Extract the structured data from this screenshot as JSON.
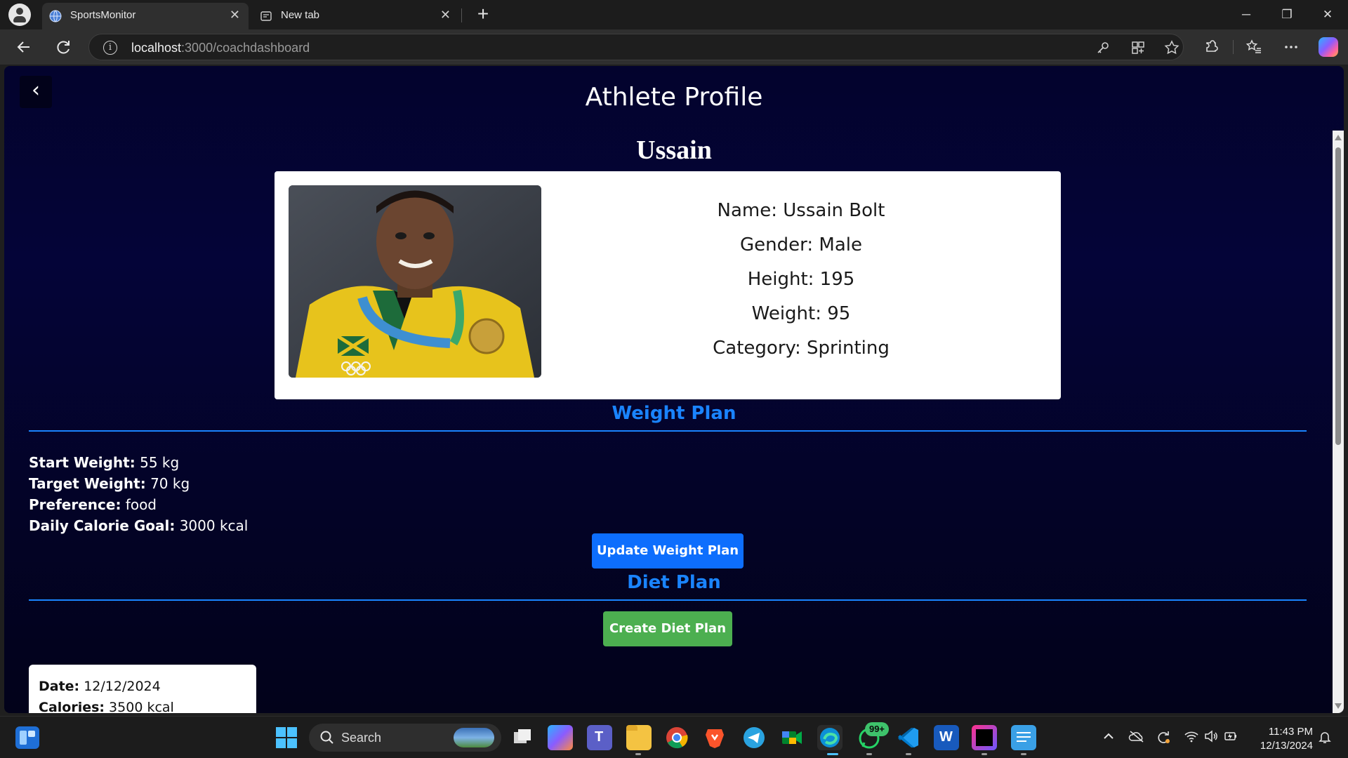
{
  "browser": {
    "tabs": [
      {
        "title": "SportsMonitor",
        "active": true
      },
      {
        "title": "New tab",
        "active": false
      }
    ],
    "tab_close_glyph": "✕",
    "new_tab_glyph": "+",
    "url_host": "localhost",
    "url_path": ":3000/coachdashboard",
    "window_controls": [
      "─",
      "❐",
      "✕"
    ],
    "icons": [
      "back-icon",
      "refresh-icon",
      "info-icon",
      "key-icon",
      "apps-icon",
      "star-icon",
      "extensions-icon",
      "favorites-icon",
      "more-icon",
      "copilot-icon"
    ]
  },
  "page": {
    "back_glyph": "‹",
    "title": "Athlete Profile",
    "athlete_first_name": "Ussain",
    "profile": {
      "name": "Name: Ussain Bolt",
      "gender": "Gender: Male",
      "height": "Height: 195",
      "weight": "Weight: 95",
      "category": "Category: Sprinting"
    },
    "weight_plan": {
      "heading": "Weight Plan",
      "start_label": "Start Weight:",
      "start_value": " 55 kg",
      "target_label": "Target Weight:",
      "target_value": " 70 kg",
      "preference_label": "Preference:",
      "preference_value": " food",
      "calorie_label": "Daily Calorie Goal:",
      "calorie_value": " 3000 kcal",
      "update_button": "Update Weight Plan"
    },
    "diet_plan": {
      "heading": "Diet Plan",
      "create_button": "Create Diet Plan",
      "entries": [
        {
          "date_label": "Date:",
          "date_value": " 12/12/2024",
          "calories_label": "Calories:",
          "calories_value": " 3500 kcal"
        }
      ]
    },
    "colors": {
      "background": "#03032d",
      "accent_blue": "#1a84ff",
      "button_blue": "#0d6efd",
      "button_green": "#4caf50"
    }
  },
  "taskbar": {
    "search_label": "Search",
    "whatsapp_badge": "99+",
    "time": "11:43 PM",
    "date": "12/13/2024",
    "apps": [
      "widgets-icon",
      "start-icon",
      "task-view-icon",
      "copilot-icon",
      "teams-icon",
      "file-explorer-icon",
      "chrome-icon",
      "brave-icon",
      "telegram-icon",
      "meet-icon",
      "edge-icon",
      "whatsapp-icon",
      "vscode-icon",
      "word-icon",
      "jetbrains-icon",
      "notepad-icon"
    ]
  }
}
